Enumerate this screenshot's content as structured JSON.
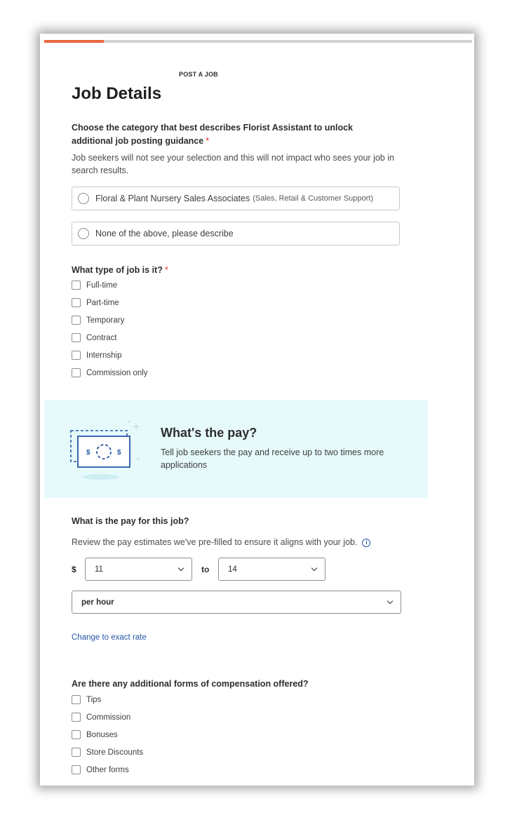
{
  "progress": {
    "fraction": 0.14
  },
  "header": {
    "eyebrow": "POST A JOB",
    "title": "Job Details"
  },
  "category": {
    "label": "Choose the category that best describes Florist Assistant to unlock additional job posting guidance",
    "required_mark": "*",
    "helper": "Job seekers will not see your selection and this will not impact who sees your job in search results.",
    "options": [
      {
        "label": "Floral & Plant Nursery Sales Associates",
        "sublabel": "(Sales, Retail & Customer Support)",
        "selected": false
      },
      {
        "label": "None of the above, please describe",
        "sublabel": "",
        "selected": false
      }
    ]
  },
  "job_type": {
    "label": "What type of job is it?",
    "required_mark": "*",
    "options": [
      {
        "label": "Full-time",
        "checked": false
      },
      {
        "label": "Part-time",
        "checked": false
      },
      {
        "label": "Temporary",
        "checked": false
      },
      {
        "label": "Contract",
        "checked": false
      },
      {
        "label": "Internship",
        "checked": false
      },
      {
        "label": "Commission only",
        "checked": false
      }
    ]
  },
  "pay_banner": {
    "title": "What's the pay?",
    "subtitle": "Tell job seekers the pay and receive up to two times more applications",
    "illustration": "money-bill-icon",
    "currency_glyph": "$"
  },
  "pay": {
    "label": "What is the pay for this job?",
    "helper": "Review the pay estimates we've pre-filled to ensure it aligns with your job.",
    "info_icon": "info-icon",
    "currency": "$",
    "min_value": "11",
    "to_label": "to",
    "max_value": "14",
    "period": "per hour",
    "change_link": "Change to exact rate"
  },
  "compensation": {
    "label": "Are there any additional forms of compensation offered?",
    "options": [
      {
        "label": "Tips",
        "checked": false
      },
      {
        "label": "Commission",
        "checked": false
      },
      {
        "label": "Bonuses",
        "checked": false
      },
      {
        "label": "Store Discounts",
        "checked": false
      },
      {
        "label": "Other forms",
        "checked": false
      }
    ]
  },
  "colors": {
    "accent": "#e8673d",
    "link": "#2557a7",
    "banner_bg": "#e7fafb",
    "required": "#d93025"
  }
}
